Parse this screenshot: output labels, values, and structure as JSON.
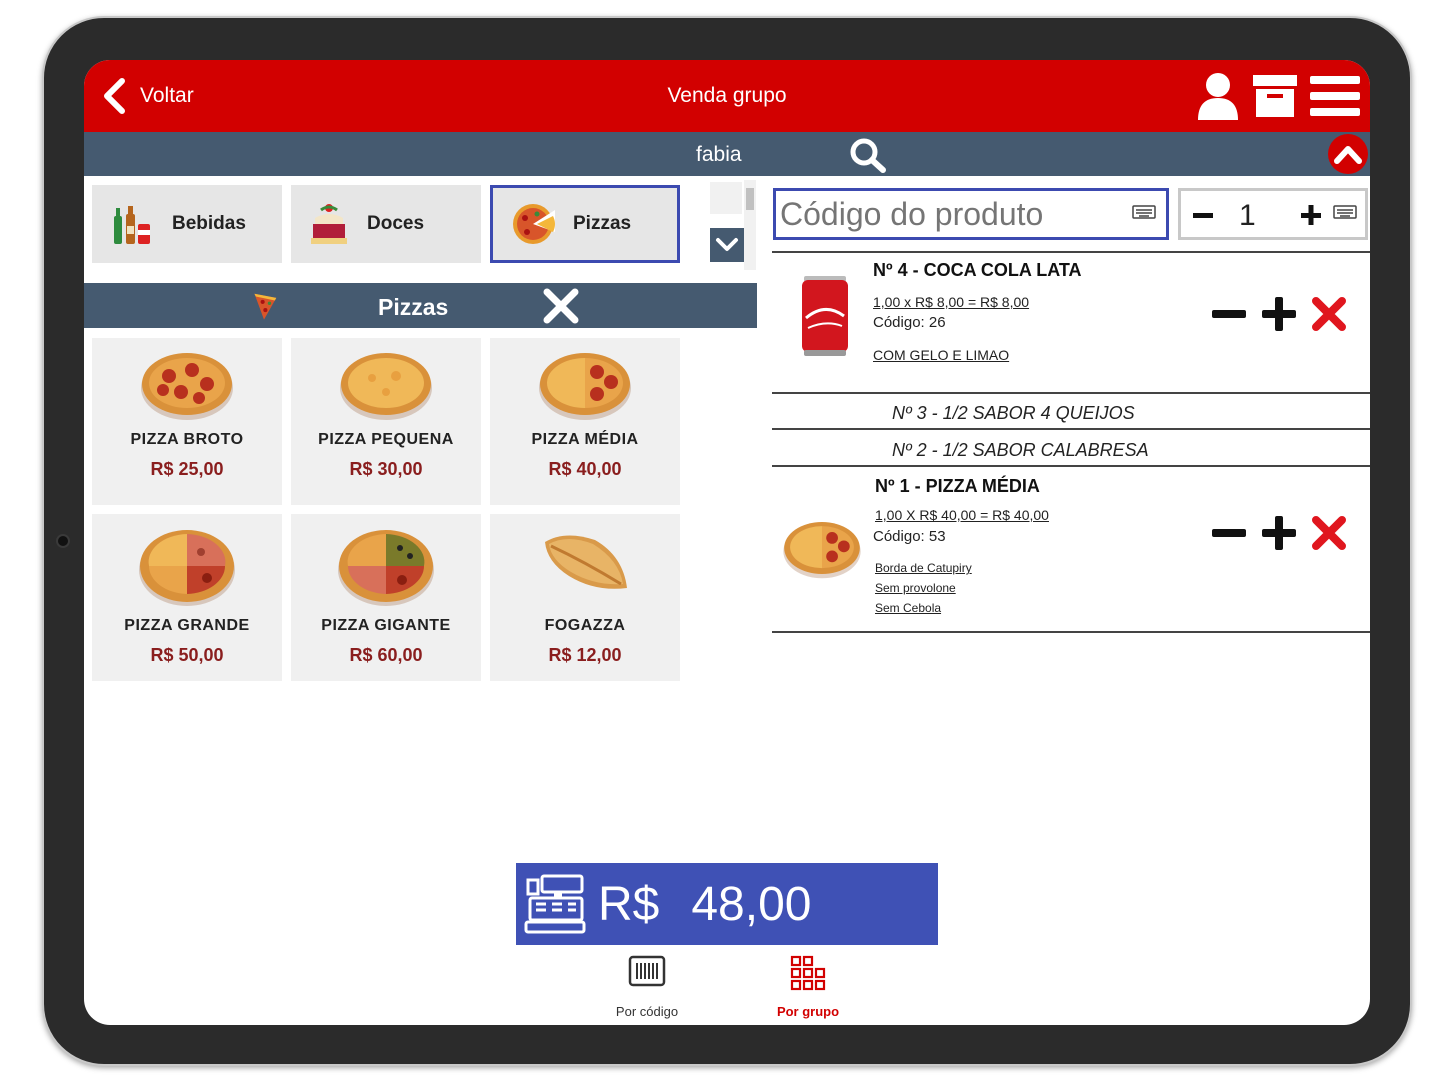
{
  "header": {
    "back_label": "Voltar",
    "title": "Venda grupo"
  },
  "subheader": {
    "user": "fabia"
  },
  "categories": [
    {
      "label": "Bebidas",
      "icon": "bottles-icon"
    },
    {
      "label": "Doces",
      "icon": "cake-icon"
    },
    {
      "label": "Pizzas",
      "icon": "pizza-slice-icon",
      "active": true
    }
  ],
  "group": {
    "title": "Pizzas"
  },
  "products": [
    {
      "name": "PIZZA BROTO",
      "price": "R$ 25,00"
    },
    {
      "name": "PIZZA PEQUENA",
      "price": "R$ 30,00"
    },
    {
      "name": "PIZZA MÉDIA",
      "price": "R$ 40,00"
    },
    {
      "name": "PIZZA GRANDE",
      "price": "R$ 50,00"
    },
    {
      "name": "PIZZA GIGANTE",
      "price": "R$ 60,00"
    },
    {
      "name": "FOGAZZA",
      "price": "R$ 12,00"
    }
  ],
  "code_input": {
    "placeholder": "Código do produto"
  },
  "quantity": {
    "value": "1"
  },
  "order": {
    "items": [
      {
        "name": "Nº 4 - COCA COLA LATA",
        "calc": "1,00 x R$ 8,00 = R$ 8,00",
        "code": "Código: 26",
        "notes": [
          "COM GELO E LIMAO"
        ]
      },
      {
        "half1": "Nº 3 - 1/2 SABOR 4 QUEIJOS",
        "half2": "Nº 2 - 1/2 SABOR CALABRESA"
      },
      {
        "name": "Nº 1 - PIZZA MÉDIA",
        "calc": "1,00 X R$ 40,00 = R$ 40,00",
        "code": "Código: 53",
        "notes": [
          "Borda de Catupiry",
          "Sem provolone",
          "Sem Cebola"
        ]
      }
    ]
  },
  "total": {
    "label": "R$",
    "value": "48,00"
  },
  "tabs": [
    {
      "label": "Por código"
    },
    {
      "label": "Por grupo",
      "active": true
    }
  ],
  "colors": {
    "header_red": "#d20000",
    "bar_slate": "#455a70",
    "accent_blue": "#3f51b5",
    "price_red": "#8a1e1e"
  }
}
